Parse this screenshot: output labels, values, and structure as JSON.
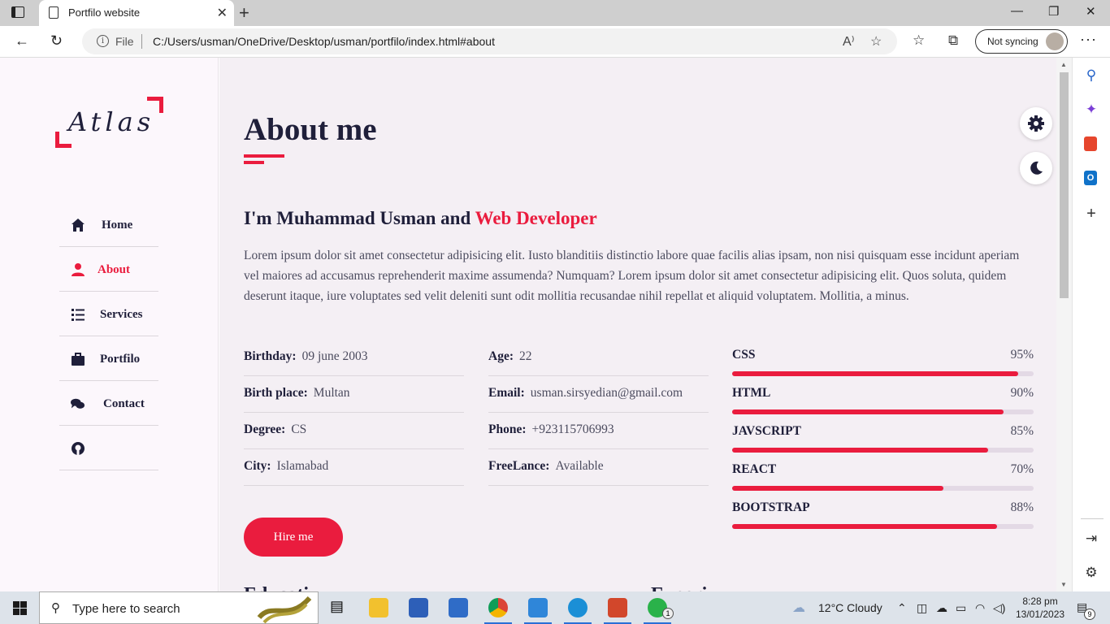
{
  "browser": {
    "tab_title": "Portfilo website",
    "file_label": "File",
    "url": "C:/Users/usman/OneDrive/Desktop/usman/portfilo/index.html#about",
    "sync_label": "Not syncing"
  },
  "sidebar": {
    "logo": "Atlas",
    "items": [
      {
        "label": "Home",
        "icon": "home-icon"
      },
      {
        "label": "About",
        "icon": "user-icon",
        "active": true
      },
      {
        "label": "Services",
        "icon": "list-icon"
      },
      {
        "label": "Portfilo",
        "icon": "briefcase-icon"
      },
      {
        "label": "Contact",
        "icon": "chat-icon"
      },
      {
        "label": "",
        "icon": "github-icon"
      }
    ]
  },
  "about": {
    "title": "About me",
    "intro_prefix": "I'm Muhammad Usman and",
    "intro_role": "Web Developer",
    "paragraph": "Lorem ipsum dolor sit amet consectetur adipisicing elit. Iusto blanditiis distinctio labore quae facilis alias ipsam, non nisi quisquam esse incidunt aperiam vel maiores ad accusamus reprehenderit maxime assumenda? Numquam? Lorem ipsum dolor sit amet consectetur adipisicing elit. Quos soluta, quidem deserunt itaque, iure voluptates sed velit deleniti sunt odit mollitia recusandae nihil repellat et aliquid voluptatem. Mollitia, a minus.",
    "info_left": [
      {
        "label": "Birthday:",
        "value": "09 june 2003"
      },
      {
        "label": "Birth place:",
        "value": "Multan"
      },
      {
        "label": "Degree:",
        "value": "CS"
      },
      {
        "label": "City:",
        "value": "Islamabad"
      }
    ],
    "info_right": [
      {
        "label": "Age:",
        "value": "22"
      },
      {
        "label": "Email:",
        "value": "usman.sirsyedian@gmail.com"
      },
      {
        "label": "Phone:",
        "value": "+923115706993"
      },
      {
        "label": "FreeLance:",
        "value": "Available"
      }
    ],
    "skills": [
      {
        "name": "CSS",
        "percent_label": "95%",
        "level": 0.95
      },
      {
        "name": "HTML",
        "percent_label": "90%",
        "level": 0.9
      },
      {
        "name": "JAVSCRIPT",
        "percent_label": "85%",
        "level": 0.85
      },
      {
        "name": "REACT",
        "percent_label": "70%",
        "level": 0.7
      },
      {
        "name": "BOOTSTRAP",
        "percent_label": "88%",
        "level": 0.88
      }
    ],
    "hire_label": "Hire me",
    "next_left": "Educati",
    "next_right": "Experi"
  },
  "taskbar": {
    "search_placeholder": "Type here to search",
    "weather": "12°C  Cloudy",
    "time": "8:28 pm",
    "date": "13/01/2023",
    "whatsapp_badge": "1",
    "notif_badge": "9"
  },
  "colors": {
    "accent": "#ea1c3e",
    "text": "#1f1f3a",
    "main_bg": "#f4eff4"
  }
}
